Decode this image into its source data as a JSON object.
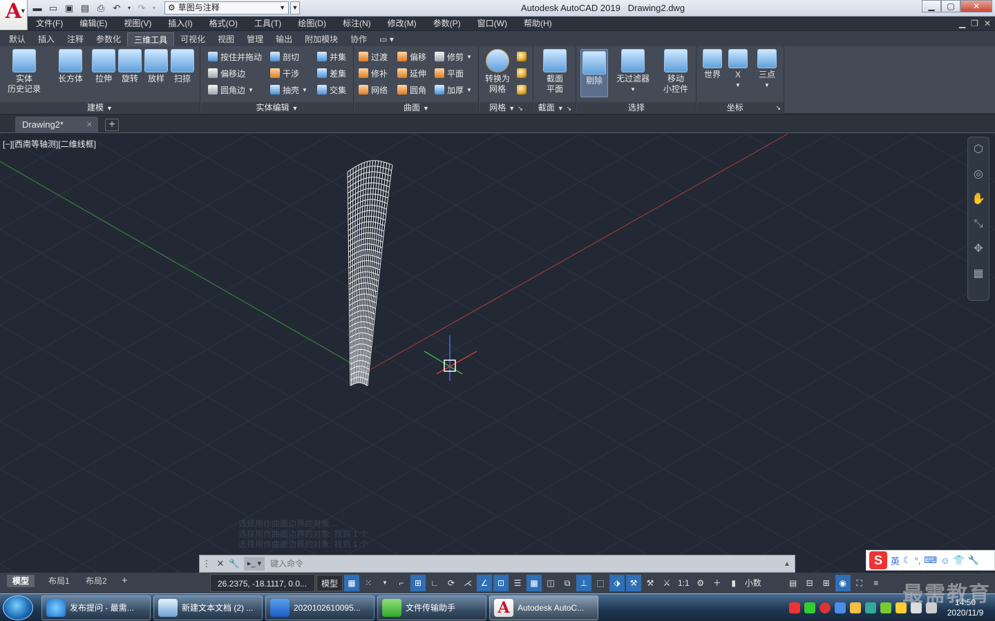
{
  "window": {
    "app_title": "Autodesk AutoCAD 2019",
    "doc_title": "Drawing2.dwg",
    "workspace": "草图与注释",
    "logo_letter": "A"
  },
  "menu": [
    "文件(F)",
    "编辑(E)",
    "视图(V)",
    "插入(I)",
    "格式(O)",
    "工具(T)",
    "绘图(D)",
    "标注(N)",
    "修改(M)",
    "参数(P)",
    "窗口(W)",
    "帮助(H)"
  ],
  "ribbon_tabs": [
    "默认",
    "插入",
    "注释",
    "参数化",
    "三维工具",
    "可视化",
    "视图",
    "管理",
    "输出",
    "附加模块",
    "协作"
  ],
  "ribbon_active_tab": "三维工具",
  "ribbon": {
    "modeling": {
      "title": "建模",
      "history": [
        "实体",
        "历史记录"
      ],
      "box": "长方体",
      "extrude": "拉伸",
      "revolve": "旋转",
      "loft": "放样",
      "sweep": "扫掠"
    },
    "solid_edit": {
      "title": "实体编辑",
      "presspull": "按住并拖动",
      "slice": "剖切",
      "union": "并集",
      "offset_edge": "偏移边",
      "interfere": "干涉",
      "subtract": "差集",
      "fillet_edge": "圆角边",
      "shell": "抽壳",
      "intersect": "交集"
    },
    "surface": {
      "title": "曲面",
      "blend": "过渡",
      "offset": "偏移",
      "trim": "修剪",
      "patch": "修补",
      "extend": "延伸",
      "planar": "平面",
      "network": "网络",
      "fillet": "圆角",
      "thicken": "加厚"
    },
    "mesh": {
      "title": "网格",
      "convert": [
        "转换为",
        "网格"
      ]
    },
    "section": {
      "title": "截面",
      "plane": [
        "截面",
        "平面"
      ]
    },
    "selection": {
      "title": "选择",
      "culling": "剔除",
      "no_filter": "无过滤器",
      "gizmo": [
        "移动",
        "小控件"
      ]
    },
    "coordinates": {
      "title": "坐标",
      "world": "世界",
      "x": "X",
      "three_point": "三点"
    }
  },
  "doc_tab": "Drawing2*",
  "viewport": {
    "label": "[−][西南等轴测][二维线框]"
  },
  "command": {
    "placeholder": "键入命令",
    "history": [
      "选择用作曲面边界的对象 ...",
      "选择用作曲面边界的对象: 找到 1 个",
      "选择用作曲面边界的对象: 找到 1 个"
    ]
  },
  "layout_tabs": [
    "模型",
    "布局1",
    "布局2"
  ],
  "status": {
    "coords": "26.2375, -18.1117, 0.0...",
    "model": "模型",
    "scale": "1:1",
    "units": "小数"
  },
  "taskbar": {
    "items": [
      "发布提问 - 最需...",
      "新建文本文档 (2) ...",
      "2020102610095...",
      "文件传输助手",
      "Autodesk AutoC..."
    ],
    "time": "14:50",
    "date": "2020/11/9"
  },
  "ime": {
    "lang": "英"
  },
  "watermark": "最需教育",
  "colors": {
    "viewport_bg": "#222935",
    "ribbon_bg": "#444b56",
    "x_axis": "#b23a3a",
    "y_axis": "#3f8f3f",
    "wireframe": "#ffffff",
    "accent": "#2f6fb5"
  }
}
